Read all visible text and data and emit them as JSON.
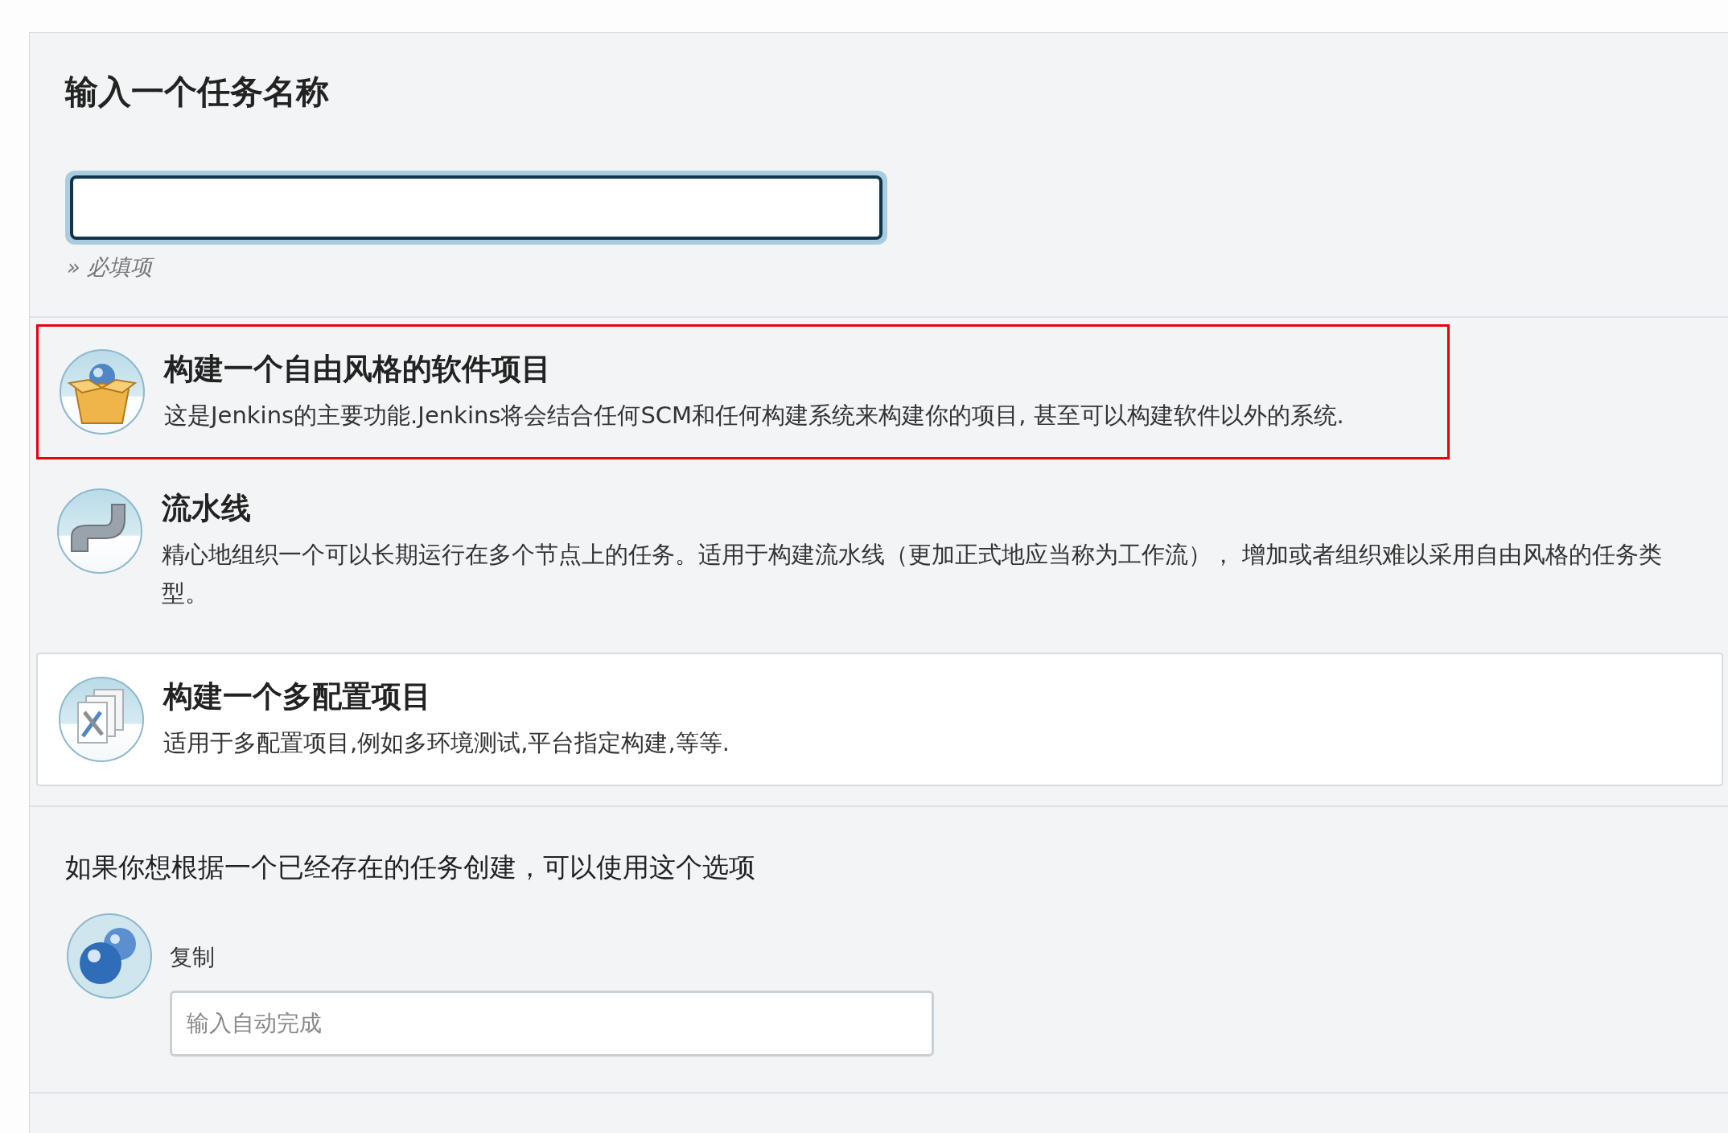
{
  "name_section": {
    "title": "输入一个任务名称",
    "name_field": {
      "focused": true
    },
    "hint": "» 必填项"
  },
  "item_types": [
    {
      "kind": "freestyle",
      "title": "构建一个自由风格的软件项目",
      "description": "这是Jenkins的主要功能.Jenkins将会结合任何SCM和任何构建系统来构建你的项目, 甚至可以构建软件以外的系统.",
      "selected": false,
      "highlighted": true
    },
    {
      "kind": "pipeline",
      "title": "流水线",
      "description": "精心地组织一个可以长期运行在多个节点上的任务。适用于构建流水线（更加正式地应当称为工作流）， 增加或者组织难以采用自由风格的任务类型。",
      "selected": false,
      "highlighted": false
    },
    {
      "kind": "matrix",
      "title": "构建一个多配置项目",
      "description": "适用于多配置项目,例如多环境测试,平台指定构建,等等.",
      "selected": true,
      "highlighted": false
    }
  ],
  "copy_section": {
    "intro": "如果你想根据一个已经存在的任务创建，可以使用这个选项",
    "label": "复制",
    "copy_field": {
      "placeholder": "输入自动完成"
    }
  }
}
